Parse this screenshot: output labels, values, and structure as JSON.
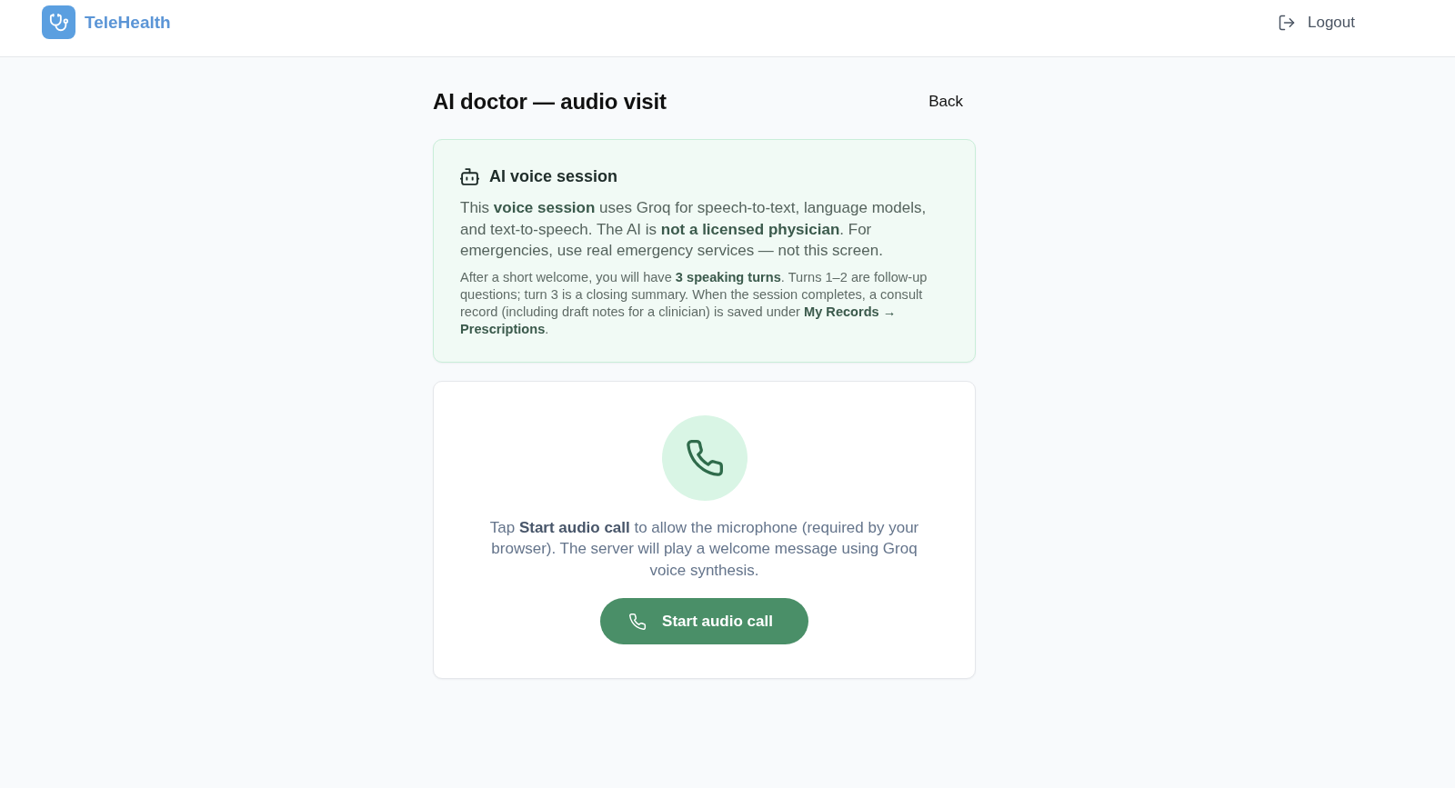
{
  "header": {
    "brand": "TeleHealth",
    "logout": "Logout"
  },
  "page": {
    "title": "AI doctor — audio visit",
    "back": "Back"
  },
  "info_card": {
    "title": "AI voice session",
    "body": "This **voice session** uses Groq for speech-to-text, language models, and text-to-speech. The AI is **not a licensed physician**. For emergencies, use real emergency services — not this screen.",
    "note": "After a short welcome, you will have **3 speaking turns**. Turns 1–2 are follow-up questions; turn 3 is a closing summary. When the session completes, a consult record (including draft notes for a clinician) is saved under **My Records →** **Prescriptions**."
  },
  "call_card": {
    "instructions": "Tap **Start audio call** to allow the microphone (required by your browser). The server will play a welcome message using Groq voice synthesis.",
    "button": "Start audio call"
  }
}
